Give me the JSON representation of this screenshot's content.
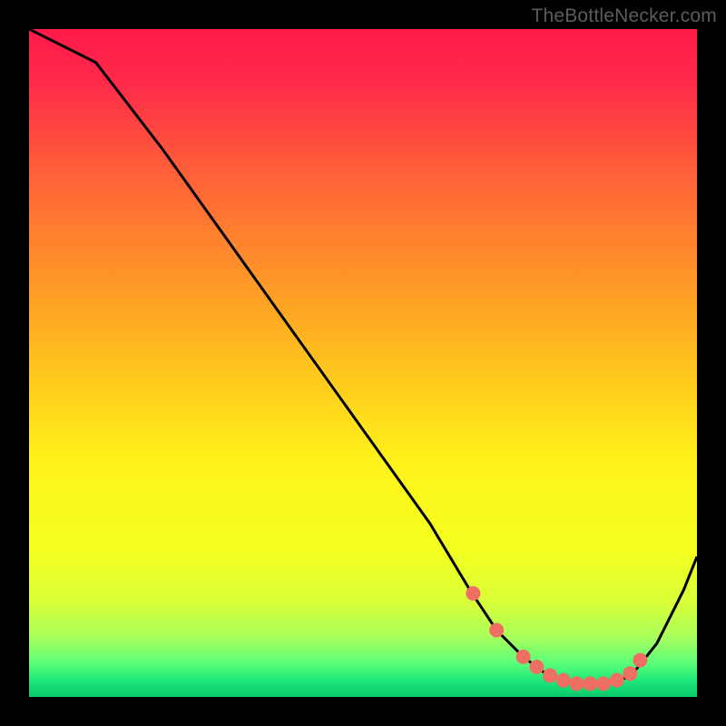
{
  "attribution": "TheBottleNecker.com",
  "chart_data": {
    "type": "line",
    "title": "",
    "xlabel": "",
    "ylabel": "",
    "xlim": [
      0,
      100
    ],
    "ylim": [
      0,
      100
    ],
    "grid": false,
    "series": [
      {
        "name": "curve",
        "x": [
          0,
          4,
          10,
          20,
          30,
          40,
          50,
          60,
          66,
          70,
          74,
          78,
          82,
          86,
          90,
          94,
          98,
          100
        ],
        "y": [
          100,
          98,
          95,
          82,
          68,
          54,
          40,
          26,
          16,
          10,
          6,
          3,
          2,
          2,
          3,
          8,
          16,
          21
        ]
      }
    ],
    "markers": {
      "name": "dots",
      "x": [
        66.5,
        70.0,
        74.0,
        76.0,
        78.0,
        80.0,
        82.0,
        84.0,
        86.0,
        88.0,
        90.0,
        91.5
      ],
      "y": [
        15.5,
        10.0,
        6.0,
        4.5,
        3.2,
        2.5,
        2.0,
        2.0,
        2.0,
        2.5,
        3.5,
        5.5
      ],
      "color": "#f06f63",
      "radius": 8
    },
    "background_gradient": {
      "stops": [
        {
          "offset": 0.0,
          "color": "#ff1a4a"
        },
        {
          "offset": 0.08,
          "color": "#ff2a4a"
        },
        {
          "offset": 0.2,
          "color": "#ff5a3a"
        },
        {
          "offset": 0.35,
          "color": "#ff8e2a"
        },
        {
          "offset": 0.5,
          "color": "#ffc21e"
        },
        {
          "offset": 0.65,
          "color": "#fff31a"
        },
        {
          "offset": 0.78,
          "color": "#f3ff1e"
        },
        {
          "offset": 0.86,
          "color": "#d8ff3a"
        },
        {
          "offset": 0.91,
          "color": "#a8ff5a"
        },
        {
          "offset": 0.95,
          "color": "#5aff7a"
        },
        {
          "offset": 0.975,
          "color": "#20e87a"
        },
        {
          "offset": 1.0,
          "color": "#08c86a"
        }
      ]
    }
  }
}
